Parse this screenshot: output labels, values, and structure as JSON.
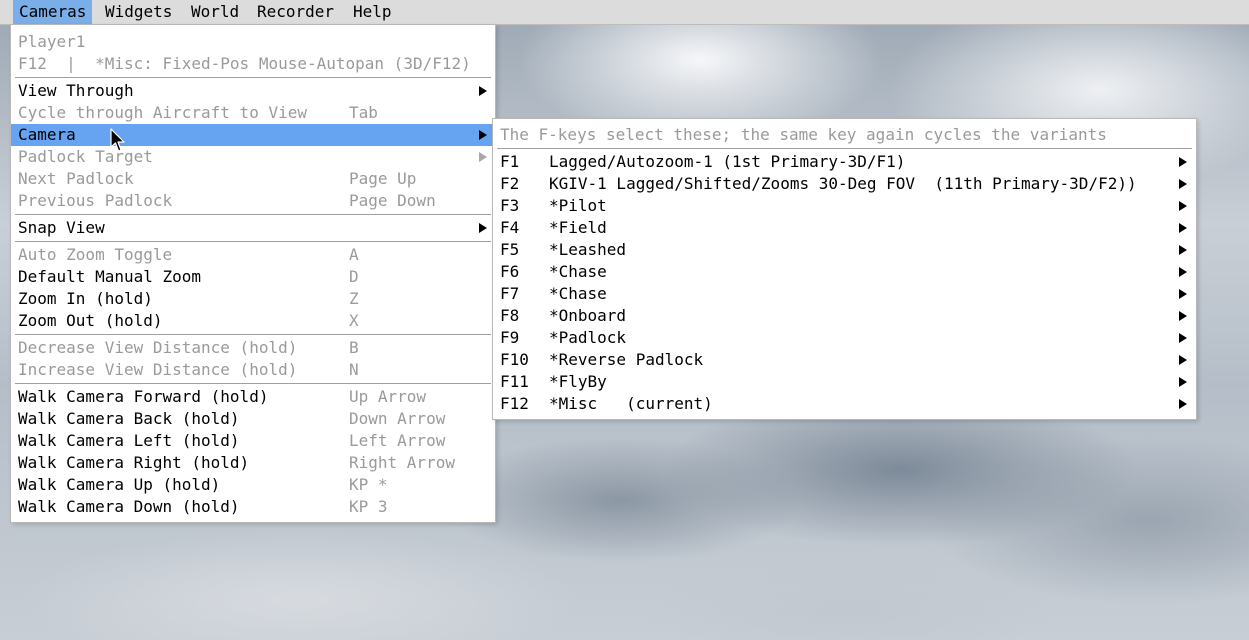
{
  "menubar": {
    "items": [
      "Cameras",
      "Widgets",
      "World",
      "Recorder",
      "Help"
    ]
  },
  "cameras_menu": {
    "header": [
      "Player1",
      "F12  |  *Misc: Fixed-Pos Mouse-Autopan (3D/F12)"
    ],
    "items": [
      {
        "label": "View Through",
        "shortcut": "",
        "submenu": true,
        "enabled": true
      },
      {
        "label": "Cycle through Aircraft to View",
        "shortcut": "Tab",
        "submenu": false,
        "enabled": false
      },
      {
        "label": "Camera",
        "shortcut": "",
        "submenu": true,
        "enabled": true,
        "highlighted": true
      },
      {
        "label": "Padlock Target",
        "shortcut": "",
        "submenu": true,
        "enabled": false
      },
      {
        "label": "Next Padlock",
        "shortcut": "Page Up",
        "submenu": false,
        "enabled": false
      },
      {
        "label": "Previous Padlock",
        "shortcut": "Page Down",
        "submenu": false,
        "enabled": false
      },
      {
        "label": "Snap View",
        "shortcut": "",
        "submenu": true,
        "enabled": true
      },
      {
        "label": "Auto Zoom Toggle",
        "shortcut": "A",
        "submenu": false,
        "enabled": false
      },
      {
        "label": "Default Manual Zoom",
        "shortcut": "D",
        "submenu": false,
        "enabled": true
      },
      {
        "label": "Zoom In (hold)",
        "shortcut": "Z",
        "submenu": false,
        "enabled": true
      },
      {
        "label": "Zoom Out (hold)",
        "shortcut": "X",
        "submenu": false,
        "enabled": true
      },
      {
        "label": "Decrease View Distance (hold)",
        "shortcut": "B",
        "submenu": false,
        "enabled": false
      },
      {
        "label": "Increase View Distance (hold)",
        "shortcut": "N",
        "submenu": false,
        "enabled": false
      },
      {
        "label": "Walk Camera Forward (hold)",
        "shortcut": "Up Arrow",
        "submenu": false,
        "enabled": true
      },
      {
        "label": "Walk Camera Back (hold)",
        "shortcut": "Down Arrow",
        "submenu": false,
        "enabled": true
      },
      {
        "label": "Walk Camera Left (hold)",
        "shortcut": "Left Arrow",
        "submenu": false,
        "enabled": true
      },
      {
        "label": "Walk Camera Right (hold)",
        "shortcut": "Right Arrow",
        "submenu": false,
        "enabled": true
      },
      {
        "label": "Walk Camera Up (hold)",
        "shortcut": "KP *",
        "submenu": false,
        "enabled": true
      },
      {
        "label": "Walk Camera Down (hold)",
        "shortcut": "KP 3",
        "submenu": false,
        "enabled": true
      }
    ]
  },
  "camera_submenu": {
    "header": "The F-keys select these; the same key again cycles the variants",
    "items": [
      {
        "key": "F1",
        "label": "Lagged/Autozoom-1 (1st Primary-3D/F1)"
      },
      {
        "key": "F2",
        "label": "KGIV-1 Lagged/Shifted/Zooms 30-Deg FOV  (11th Primary-3D/F2))"
      },
      {
        "key": "F3",
        "label": "*Pilot"
      },
      {
        "key": "F4",
        "label": "*Field"
      },
      {
        "key": "F5",
        "label": "*Leashed"
      },
      {
        "key": "F6",
        "label": "*Chase"
      },
      {
        "key": "F7",
        "label": "*Chase"
      },
      {
        "key": "F8",
        "label": "*Onboard"
      },
      {
        "key": "F9",
        "label": "*Padlock"
      },
      {
        "key": "F10",
        "label": "*Reverse Padlock"
      },
      {
        "key": "F11",
        "label": "*FlyBy"
      },
      {
        "key": "F12",
        "label": "*Misc   (current)"
      }
    ]
  },
  "colors": {
    "menubar_active": "#7aaee8",
    "highlight": "#66a3f0",
    "disabled_text": "#9a9a9a"
  },
  "icons": [
    "submenu-arrow-icon",
    "mouse-pointer-icon"
  ]
}
